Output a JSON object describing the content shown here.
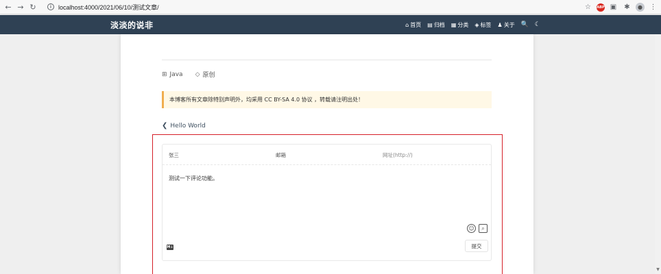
{
  "browser": {
    "url": "localhost:4000/2021/06/10/测试文章/",
    "back_icon": "←",
    "forward_icon": "→",
    "reload_icon": "↻",
    "info_icon": "i",
    "star_icon": "☆",
    "abp_label": "ABP",
    "cast_icon": "▣",
    "extensions_icon": "✱",
    "profile_icon": "●",
    "menu_icon": "⋮"
  },
  "site": {
    "brand": "淡淡的说非",
    "menu": [
      {
        "icon": "⌂",
        "label": "首页"
      },
      {
        "icon": "▤",
        "label": "归档"
      },
      {
        "icon": "▦",
        "label": "分类"
      },
      {
        "icon": "◈",
        "label": "标签"
      },
      {
        "icon": "♟",
        "label": "关于"
      }
    ],
    "search_icon": "🔍",
    "theme_icon": "☾"
  },
  "post": {
    "category_icon": "⊞",
    "category": "Java",
    "tag_icon": "◇",
    "tag": "原创",
    "license": "本博客所有文章除特别声明外，均采用 CC BY-SA 4.0 协议 ，转载请注明出处！",
    "prev_chevron": "❮",
    "prev_title": "Hello World"
  },
  "comment": {
    "name_value": "张三",
    "email_placeholder": "邮箱",
    "site_placeholder": "网址(http://)",
    "content": "测试一下评论功能。",
    "emoji_icon": "☺",
    "preview_icon": "⌕",
    "markdown_badge": "M↓",
    "submit_label": "提交"
  }
}
